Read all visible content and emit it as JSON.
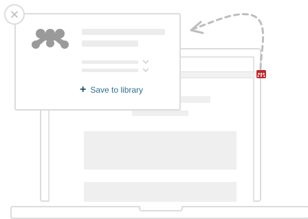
{
  "popup": {
    "save_label": "Save to library"
  },
  "icons": {
    "close": "close-icon",
    "logo": "mendeley-logo",
    "extension": "mendeley-extension-icon",
    "chevron": "chevron-down-icon",
    "plus": "plus-icon",
    "arrow": "dashed-arrow"
  },
  "colors": {
    "accent_blue": "#2f6f95",
    "brand_red": "#c0282d",
    "outline_gray": "#dcdcdc",
    "placeholder_gray": "#ececec"
  }
}
